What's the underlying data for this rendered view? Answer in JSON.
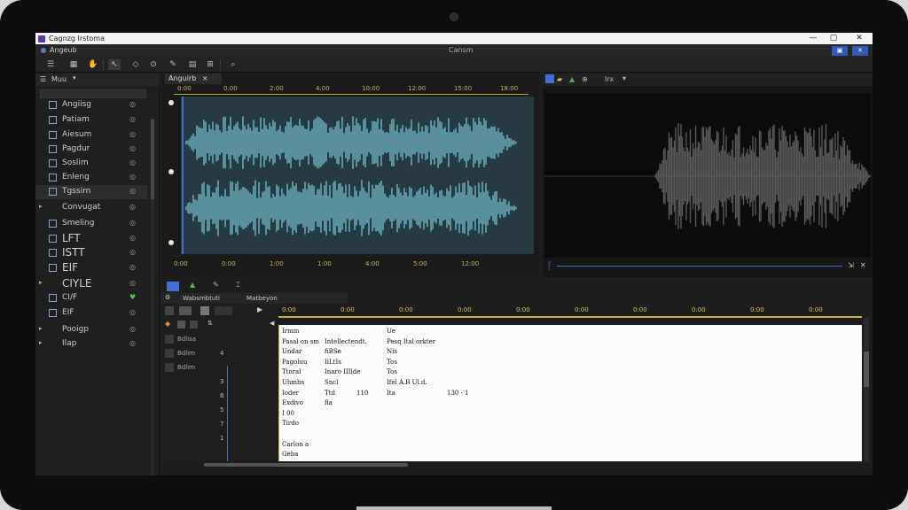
{
  "window": {
    "title": "Cagnzg Irstoma",
    "app_name": "Angeub",
    "center_label": "Cansm",
    "controls": [
      "—",
      "▢",
      "✕"
    ]
  },
  "left_panel": {
    "header": "Muu",
    "items": [
      {
        "label": "Angiisg",
        "checkbox": true
      },
      {
        "label": "Patiam",
        "checkbox": true
      },
      {
        "label": "Aiesum",
        "checkbox": true
      },
      {
        "label": "Pagdur",
        "checkbox": true
      },
      {
        "label": "Soslim",
        "checkbox": true
      },
      {
        "label": "Enleng",
        "checkbox": true
      },
      {
        "label": "Tgssirn",
        "checkbox": true,
        "selected": true
      },
      {
        "label": "Convugat",
        "checkbox": false
      },
      {
        "label": "Smeling",
        "checkbox": true
      },
      {
        "label": "LFT",
        "checkbox": true
      },
      {
        "label": "ISTT",
        "checkbox": true
      },
      {
        "label": "EIF",
        "checkbox": true
      },
      {
        "label": "CIYLE",
        "checkbox": false
      },
      {
        "label": "CI/F",
        "checkbox": true
      },
      {
        "label": "EIF",
        "checkbox": true
      },
      {
        "label": "Pooigp",
        "checkbox": false
      },
      {
        "label": "Ilap",
        "checkbox": false
      }
    ]
  },
  "wave_editor": {
    "tab_label": "Anguirb",
    "ruler_top": [
      "0:00",
      "0:00",
      "2:00",
      "4:00",
      "10:00",
      "12:00",
      "15:00",
      "18:00"
    ],
    "ruler_bottom": [
      "0:00",
      "0:00",
      "1:00",
      "1:00",
      "4:00",
      "5:00",
      "12:00"
    ]
  },
  "preview": {
    "tab_label": "Irx"
  },
  "lower": {
    "tabs": [
      "Wabsmbtuti",
      "Matbeyon"
    ],
    "ruler": [
      "0:00",
      "0:00",
      "0:00",
      "0:00",
      "0:00",
      "0:00",
      "0:00",
      "0:00",
      "0:00",
      "0:00"
    ],
    "tracks": [
      {
        "label": "Bdlisa",
        "num": ""
      },
      {
        "label": "Bdlim",
        "num": "4"
      },
      {
        "label": "Bdlim",
        "num": ""
      },
      {
        "label": "",
        "num": "3"
      },
      {
        "label": "",
        "num": "8"
      },
      {
        "label": "",
        "num": "5"
      },
      {
        "label": "",
        "num": "7"
      },
      {
        "label": "",
        "num": "1"
      }
    ],
    "rows": [
      [
        "Irmm",
        "",
        "",
        "Ue",
        ""
      ],
      [
        "Pasal on sm",
        "Intellectendt.",
        "",
        "Pesq Ital orkter",
        ""
      ],
      [
        "Undar",
        "fiBSe",
        "",
        "Nis",
        ""
      ],
      [
        "Pagoluu",
        "IiLtIs",
        "",
        "Tos",
        ""
      ],
      [
        "Ttoral",
        "Inaro IIIlde",
        "",
        "Tos",
        ""
      ],
      [
        "Uhmbs",
        "Sncl",
        "",
        "Ifel A.B Ul.d.",
        ""
      ],
      [
        "Ioder",
        "Ttd",
        "110",
        "Ita",
        "130 · 1"
      ],
      [
        "Exdivo",
        "fla",
        "",
        "",
        ""
      ],
      [
        "I 00",
        "",
        "",
        "",
        ""
      ],
      [
        "Tirdo",
        "",
        "",
        "",
        ""
      ],
      [
        "",
        "",
        "",
        "",
        ""
      ],
      [
        "Carlon a",
        "",
        "",
        "",
        ""
      ],
      [
        "Geba",
        "",
        "",
        "",
        ""
      ]
    ]
  },
  "colors": {
    "accent_blue": "#3f6fd4",
    "wave_fill": "#5e9aa6",
    "ruler_gold": "#c8b45a"
  }
}
